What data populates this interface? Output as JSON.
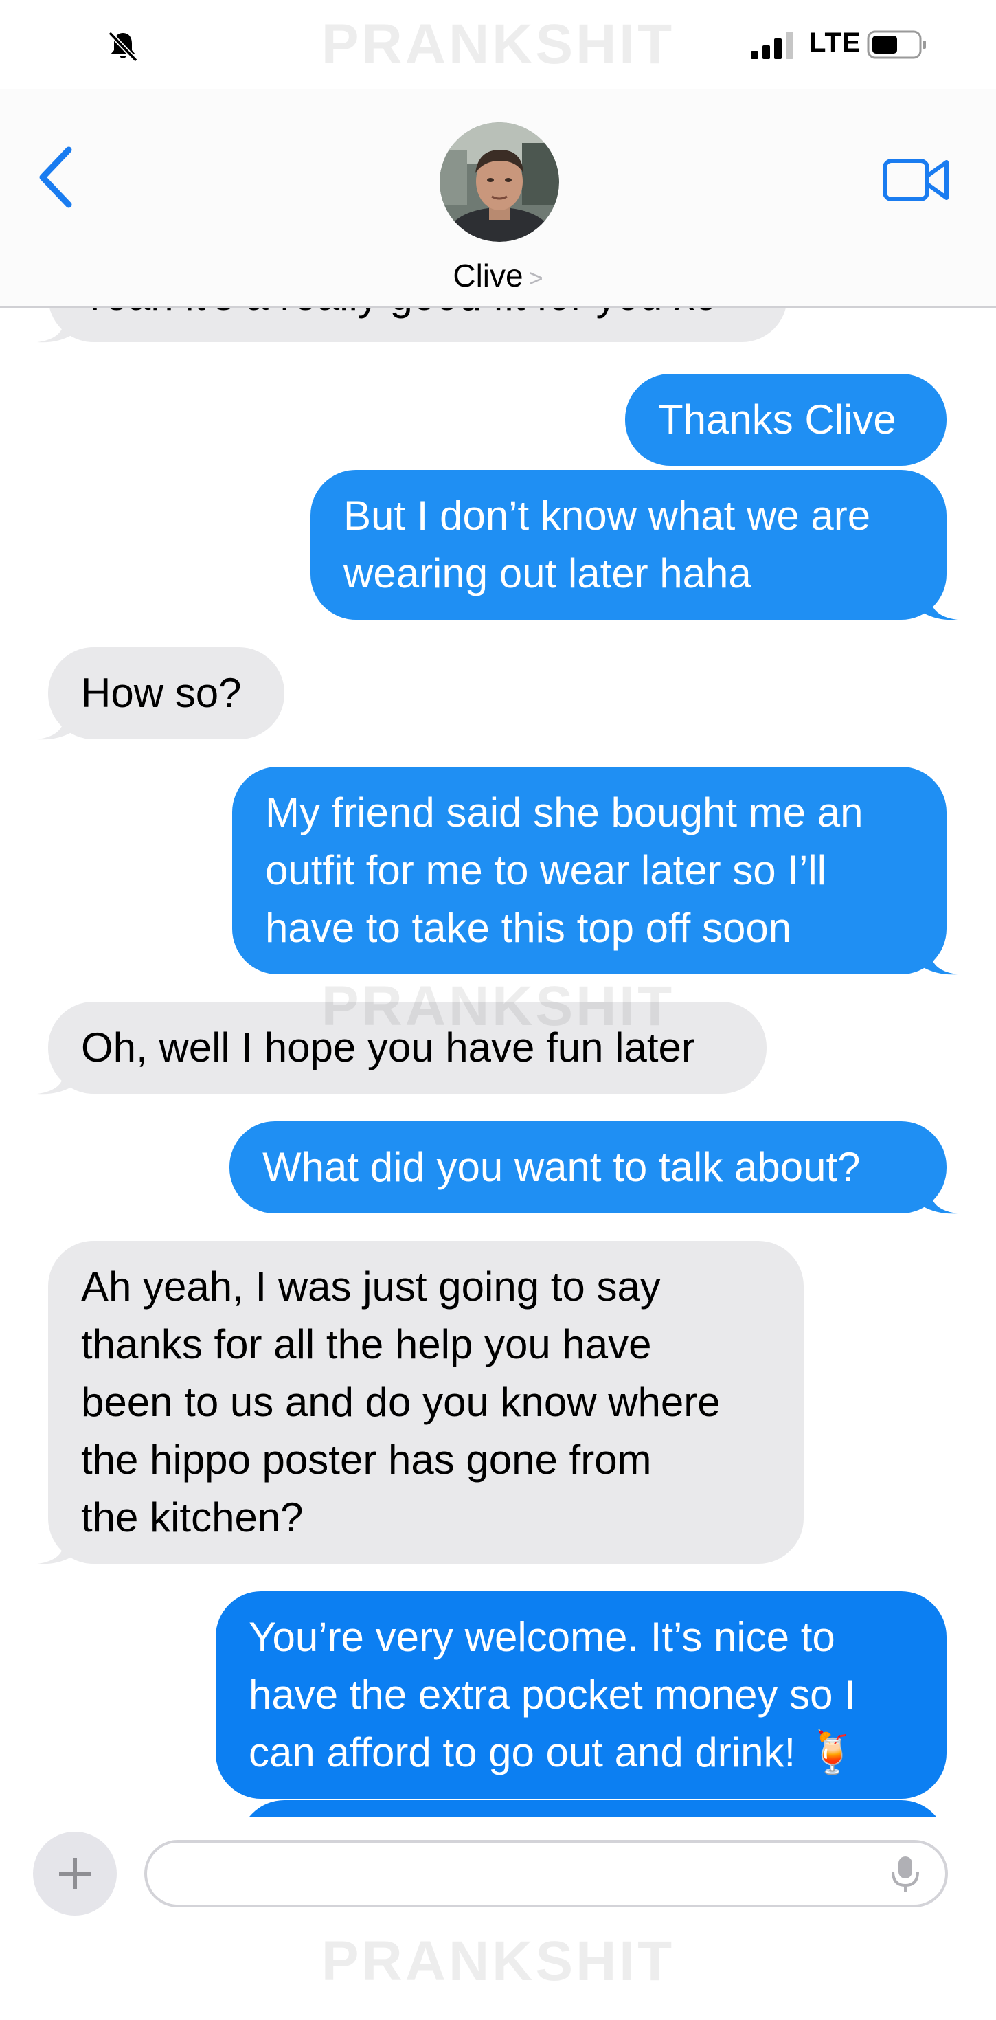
{
  "watermark": "PRANKSHIT",
  "status_bar": {
    "network": "LTE",
    "icons": [
      "bell-slash-icon",
      "signal-icon",
      "battery-icon"
    ]
  },
  "header": {
    "contact_name": "Clive",
    "chevron": ">",
    "icons": [
      "back-chevron-icon",
      "video-camera-icon"
    ]
  },
  "messages": [
    {
      "direction": "in",
      "lines": [
        "Yeah it's a really good fit for you xo"
      ]
    },
    {
      "direction": "out",
      "lines": [
        "Thanks Clive"
      ]
    },
    {
      "direction": "out",
      "lines": [
        "But I don’t know what we are",
        "wearing out later haha"
      ]
    },
    {
      "direction": "in",
      "lines": [
        "How so?"
      ]
    },
    {
      "direction": "out",
      "lines": [
        "My friend said she bought me an",
        "outfit for me to wear later so I’ll",
        "have to take this top off soon"
      ]
    },
    {
      "direction": "in",
      "lines": [
        "Oh, well I hope you have fun later"
      ]
    },
    {
      "direction": "out",
      "lines": [
        "What did you want to talk about?"
      ]
    },
    {
      "direction": "in",
      "lines": [
        "Ah yeah, I was just going to say",
        "thanks for all the help you have",
        "been to us and do you know where",
        "the hippo poster has gone from",
        "the kitchen?"
      ]
    },
    {
      "direction": "out",
      "lines": [
        "You’re very welcome. It’s nice to",
        "have the extra pocket money so I",
        "can afford to go out and drink! 🍹"
      ]
    }
  ],
  "compose": {
    "input_placeholder": "",
    "icons": [
      "plus-icon",
      "microphone-icon"
    ]
  },
  "colors": {
    "outgoing_bubble": "#1f8ff3",
    "incoming_bubble": "#e9e9eb",
    "accent": "#1a7cf0"
  }
}
